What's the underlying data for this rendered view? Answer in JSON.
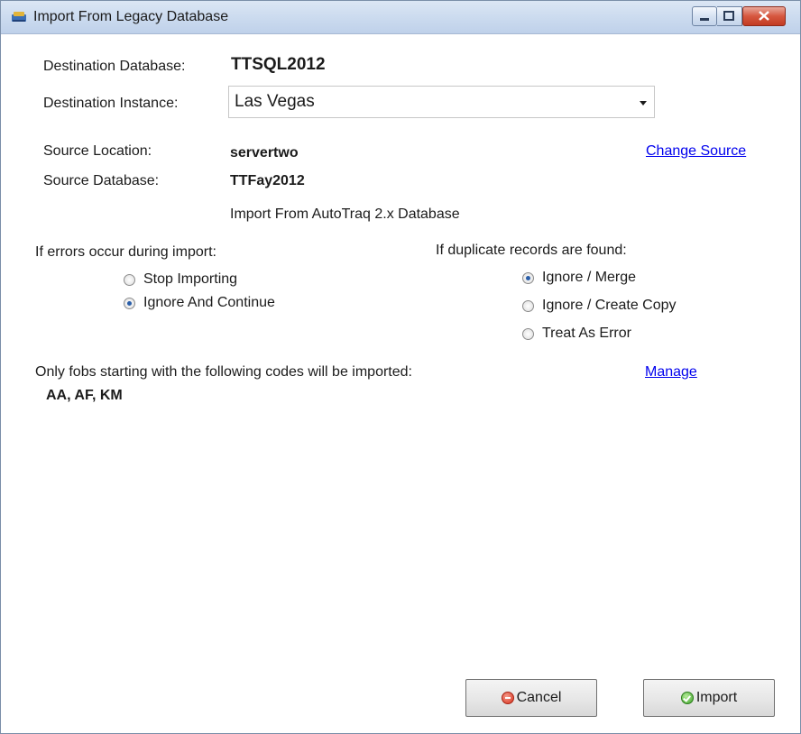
{
  "window": {
    "title": "Import From Legacy Database"
  },
  "destination": {
    "database_label": "Destination Database:",
    "database_value": "TTSQL2012",
    "instance_label": "Destination Instance:",
    "instance_value": "Las Vegas"
  },
  "source": {
    "location_label": "Source Location:",
    "location_value": "servertwo",
    "change_link": "Change Source",
    "database_label": "Source Database:",
    "database_value": "TTFay2012",
    "import_from": "Import From AutoTraq 2.x Database"
  },
  "errors": {
    "heading": "If errors occur during import:",
    "options": [
      {
        "label": "Stop Importing",
        "checked": false
      },
      {
        "label": "Ignore And Continue",
        "checked": true
      }
    ]
  },
  "duplicates": {
    "heading": "If duplicate records are found:",
    "options": [
      {
        "label": "Ignore / Merge",
        "checked": true
      },
      {
        "label": "Ignore / Create Copy",
        "checked": false
      },
      {
        "label": "Treat As Error",
        "checked": false
      }
    ]
  },
  "fobs": {
    "note": "Only fobs starting with the following codes will be imported:",
    "manage_link": "Manage",
    "codes": "AA, AF, KM"
  },
  "buttons": {
    "cancel": "Cancel",
    "import": "Import"
  }
}
